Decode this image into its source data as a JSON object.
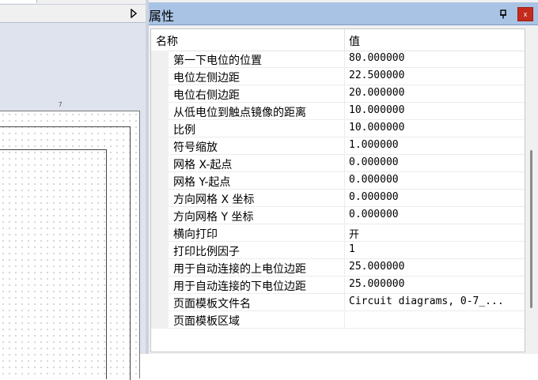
{
  "canvas": {
    "ruler_label": "7"
  },
  "icons": {
    "play": "play-icon",
    "pin": "pin-icon",
    "close": "close-icon"
  },
  "properties_panel": {
    "title": "属性",
    "close_label": "x",
    "columns": {
      "name": "名称",
      "value": "值"
    },
    "rows": [
      {
        "name": "第一下电位的位置",
        "value": "80.000000"
      },
      {
        "name": "电位左侧边距",
        "value": "22.500000"
      },
      {
        "name": "电位右侧边距",
        "value": "20.000000"
      },
      {
        "name": "从低电位到触点镜像的距离",
        "value": "10.000000"
      },
      {
        "name": "比例",
        "value": "10.000000"
      },
      {
        "name": "符号缩放",
        "value": "1.000000"
      },
      {
        "name": "网格 X-起点",
        "value": "0.000000"
      },
      {
        "name": "网格 Y-起点",
        "value": "0.000000"
      },
      {
        "name": "方向网格 X 坐标",
        "value": "0.000000"
      },
      {
        "name": "方向网格 Y 坐标",
        "value": "0.000000"
      },
      {
        "name": "横向打印",
        "value": "开"
      },
      {
        "name": "打印比例因子",
        "value": "1"
      },
      {
        "name": "用于自动连接的上电位边距",
        "value": "25.000000"
      },
      {
        "name": "用于自动连接的下电位边距",
        "value": "25.000000"
      },
      {
        "name": "页面模板文件名",
        "value": "Circuit diagrams, 0-7_..."
      },
      {
        "name": "页面模板区域",
        "value": ""
      }
    ]
  },
  "colors": {
    "title_bar": "#a9c3e4",
    "close_button": "#c42b1c",
    "canvas_background": "#dfe3ee"
  }
}
